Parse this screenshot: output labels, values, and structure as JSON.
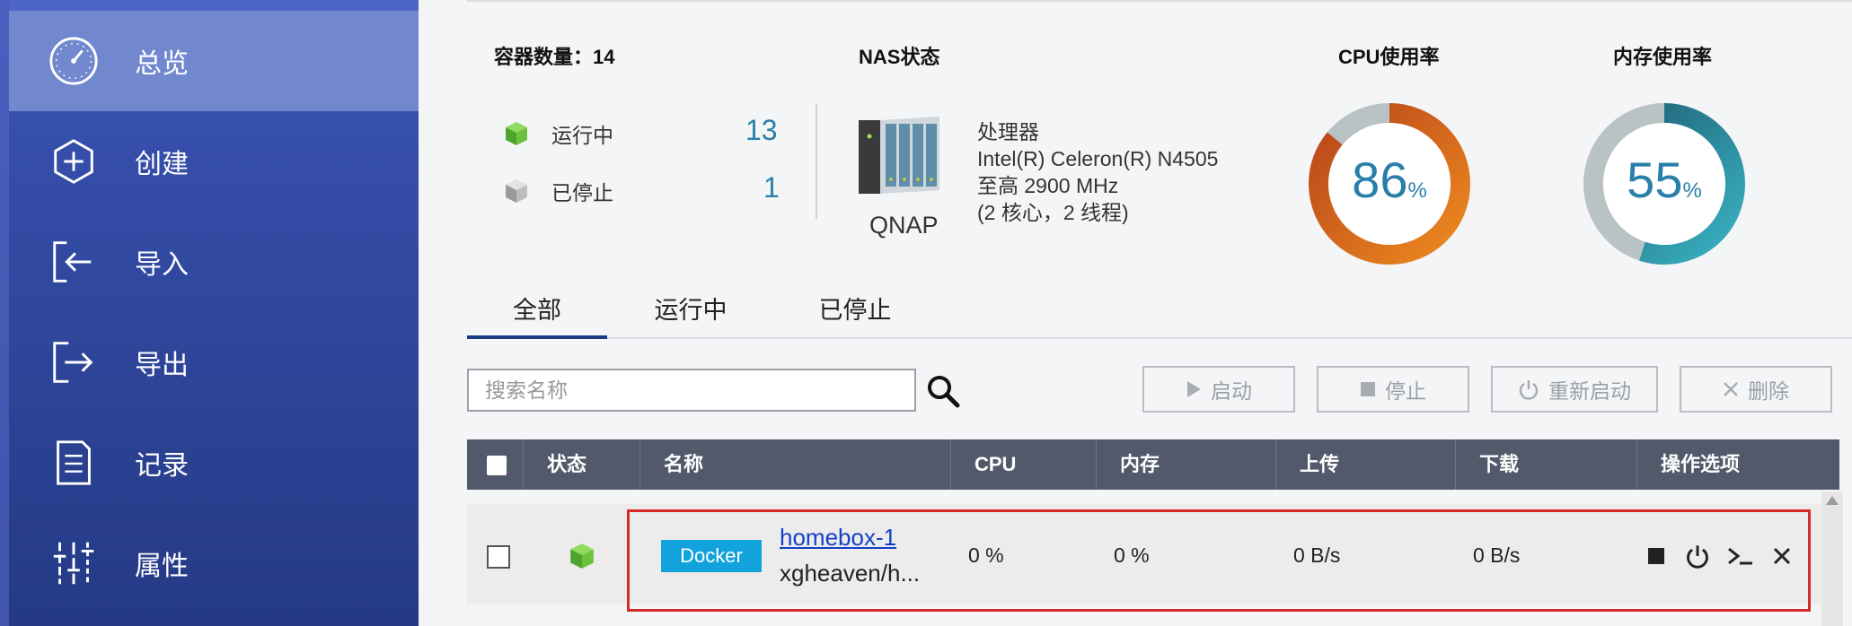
{
  "sidebar": {
    "items": [
      {
        "label": "总览",
        "icon": "dashboard-gauge-icon",
        "active": true
      },
      {
        "label": "创建",
        "icon": "plus-hexagon-icon",
        "active": false
      },
      {
        "label": "导入",
        "icon": "import-icon",
        "active": false
      },
      {
        "label": "导出",
        "icon": "export-icon",
        "active": false
      },
      {
        "label": "记录",
        "icon": "document-log-icon",
        "active": false
      },
      {
        "label": "属性",
        "icon": "sliders-icon",
        "active": false
      }
    ]
  },
  "overview": {
    "container_count_label": "容器数量：14",
    "running_label": "运行中",
    "running_count": "13",
    "stopped_label": "已停止",
    "stopped_count": "1",
    "nas_title": "NAS状态",
    "nas_name": "QNAP",
    "cpu_lines": [
      "处理器",
      "Intel(R) Celeron(R) N4505",
      "至高 2900 MHz",
      "(2 核心，2 线程)"
    ],
    "cpu_title": "CPU使用率",
    "cpu_value": "86",
    "cpu_percent": 86,
    "mem_title": "内存使用率",
    "mem_value": "55",
    "mem_percent": 55,
    "percent_sign": "%"
  },
  "tabs": [
    {
      "label": "全部",
      "active": true
    },
    {
      "label": "运行中",
      "active": false
    },
    {
      "label": "已停止",
      "active": false
    }
  ],
  "toolbar": {
    "search_placeholder": "搜索名称",
    "start_label": "启动",
    "stop_label": "停止",
    "restart_label": "重新启动",
    "delete_label": "删除"
  },
  "table": {
    "columns": [
      "状态",
      "名称",
      "CPU",
      "内存",
      "上传",
      "下载",
      "操作选项"
    ],
    "rows": [
      {
        "type": "Docker",
        "name": "homebox-1",
        "image": "xgheaven/h...",
        "cpu": "0 %",
        "mem": "0 %",
        "upload": "0 B/s",
        "download": "0 B/s"
      }
    ]
  },
  "colors": {
    "sidebar_bg": "#3148a0",
    "sidebar_active": "#7188cf",
    "accent_blue": "#2a7fa8",
    "cpu_ring": "#d9691f",
    "mem_ring": "#2a9fb0",
    "docker_badge": "#12a2dc",
    "highlight": "#d42a2a",
    "running_green": "#5cbf3a"
  }
}
